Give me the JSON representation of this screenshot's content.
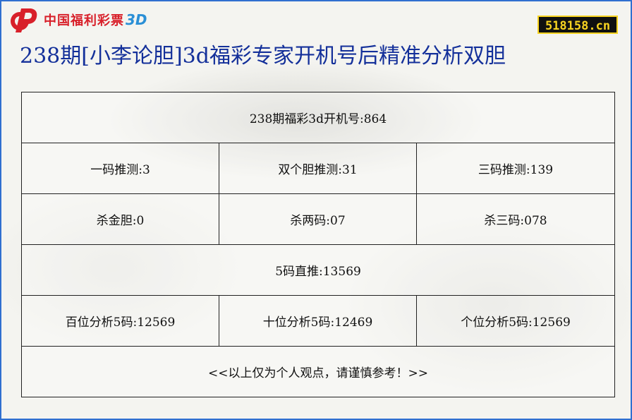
{
  "brand": {
    "logo_text": "中国福利彩票",
    "logo_3d": "3D",
    "site_badge": "518158.cn",
    "accent_red": "#d8202a",
    "accent_blue": "#2a8fd6"
  },
  "title": "238期[小李论胆]3d福彩专家开机号后精准分析双胆",
  "table": {
    "row1": "238期福彩3d开机号:864",
    "row2": [
      "一码推测:3",
      "双个胆推测:31",
      "三码推测:139"
    ],
    "row3": [
      "杀金胆:0",
      "杀两码:07",
      "杀三码:078"
    ],
    "row4": "5码直推:13569",
    "row5": [
      "百位分析5码:12569",
      "十位分析5码:12469",
      "个位分析5码:12569"
    ],
    "row6": "<<以上仅为个人观点，请谨慎参考！>>"
  },
  "colors": {
    "title": "#14309a",
    "border": "#2f6fd0"
  }
}
